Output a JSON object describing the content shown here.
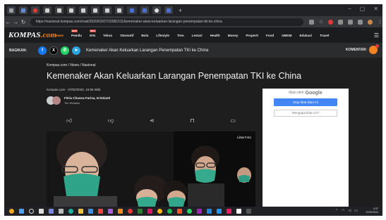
{
  "browser": {
    "url": "https://nasional.kompas.com/read/2020/02/07/15581511/kemenaker-akan-keluarkan-larangan-penempatan-tki-ke-china",
    "tab_count": 12,
    "new_tab_glyph": "+",
    "window_controls": [
      "−",
      "▢",
      "✕"
    ]
  },
  "site": {
    "logo_main": "KOMPAS",
    "logo_suffix": ".com",
    "nav": [
      {
        "label": "News",
        "active": true,
        "new": false
      },
      {
        "label": "Pemilu",
        "active": false,
        "new": true
      },
      {
        "label": "IKN",
        "active": false,
        "new": true
      },
      {
        "label": "Tekno",
        "active": false,
        "new": false
      },
      {
        "label": "Otomotif",
        "active": false,
        "new": false
      },
      {
        "label": "Bola",
        "active": false,
        "new": false
      },
      {
        "label": "Lifestyle",
        "active": false,
        "new": false
      },
      {
        "label": "Tren",
        "active": false,
        "new": false
      },
      {
        "label": "Lestari",
        "active": false,
        "new": false
      },
      {
        "label": "Health",
        "active": false,
        "new": false
      },
      {
        "label": "Money",
        "active": false,
        "new": false
      },
      {
        "label": "Properti",
        "active": false,
        "new": false
      },
      {
        "label": "Food",
        "active": false,
        "new": false
      },
      {
        "label": "UMKM",
        "active": false,
        "new": false
      },
      {
        "label": "Edukasi",
        "active": false,
        "new": false
      },
      {
        "label": "Travel",
        "active": false,
        "new": false
      }
    ],
    "new_badge": "NEW",
    "accent": "#f58220"
  },
  "sharebar": {
    "label": "BAGIKAN:",
    "title": "Kemenaker Akan Keluarkan Larangan Penempatan TKI ke China",
    "comment_label": "KOMENTAR:"
  },
  "article": {
    "breadcrumb": "Kompas.com / News / Nasional",
    "headline": "Kemenaker Akan Keluarkan Larangan Penempatan TKI ke China",
    "meta": "Kompas.com - 07/02/2020, 15:56 WIB",
    "authors": "Fitria Chusna Farisa, Kristianti",
    "author_role": "Tim Redaksi",
    "photo_link": "Lihat Foto"
  },
  "ad": {
    "label": "Iklan oleh",
    "provider": "Google",
    "stop_button": "Stop lihat iklan ini",
    "why_button": "Mengapa iklan ini?"
  },
  "taskbar": {
    "time": "9:37",
    "date": "12/02/2024",
    "tray_lang": "IN"
  }
}
